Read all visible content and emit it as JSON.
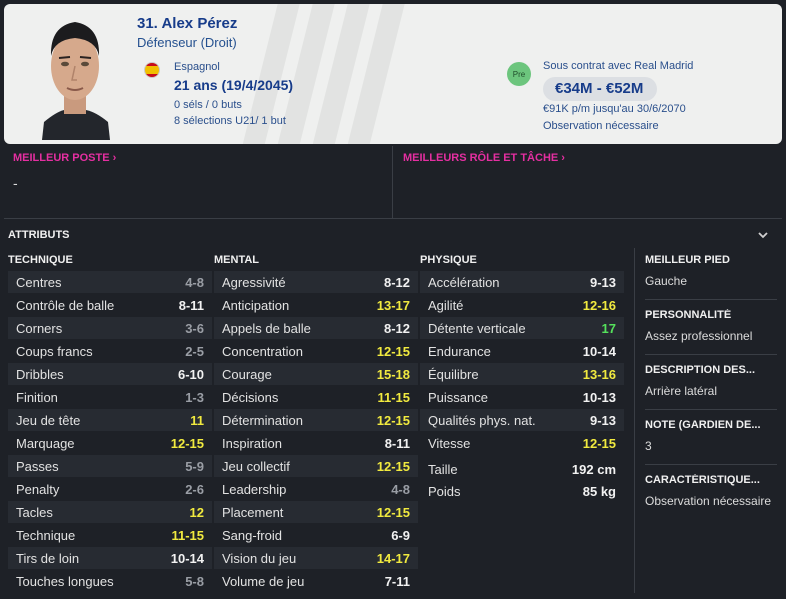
{
  "player": {
    "name": "31. Alex Pérez",
    "position": "Défenseur (Droit)",
    "nationality": "Espagnol",
    "age": "21 ans (19/4/2045)",
    "caps": "0 séls / 0 buts",
    "u21": "8 sélections U21/ 1 but"
  },
  "contract": {
    "badge": "Pre",
    "club_line": "Sous contrat avec Real Madrid",
    "value": "€34M - €52M",
    "wage": "€91K p/m jusqu'au 30/6/2070",
    "observation": "Observation nécessaire"
  },
  "best_position": {
    "title": "MEILLEUR POSTE",
    "value": "-"
  },
  "best_role": {
    "title": "MEILLEURS RÔLE ET TÂCHE"
  },
  "attributes_title": "ATTRIBUTS",
  "colors": {
    "grey": "#9a9ea5",
    "white": "#f2f2f2",
    "yellow": "#f1ea3f",
    "green": "#55e25c",
    "accent": "#e52fa1"
  },
  "technique": {
    "title": "TECHNIQUE",
    "rows": [
      {
        "label": "Centres",
        "value": "4-8",
        "tone": "grey"
      },
      {
        "label": "Contrôle de balle",
        "value": "8-11",
        "tone": "white"
      },
      {
        "label": "Corners",
        "value": "3-6",
        "tone": "grey"
      },
      {
        "label": "Coups francs",
        "value": "2-5",
        "tone": "grey"
      },
      {
        "label": "Dribbles",
        "value": "6-10",
        "tone": "white"
      },
      {
        "label": "Finition",
        "value": "1-3",
        "tone": "grey"
      },
      {
        "label": "Jeu de tête",
        "value": "11",
        "tone": "yellow"
      },
      {
        "label": "Marquage",
        "value": "12-15",
        "tone": "yellow"
      },
      {
        "label": "Passes",
        "value": "5-9",
        "tone": "grey"
      },
      {
        "label": "Penalty",
        "value": "2-6",
        "tone": "grey"
      },
      {
        "label": "Tacles",
        "value": "12",
        "tone": "yellow"
      },
      {
        "label": "Technique",
        "value": "11-15",
        "tone": "yellow"
      },
      {
        "label": "Tirs de loin",
        "value": "10-14",
        "tone": "white"
      },
      {
        "label": "Touches longues",
        "value": "5-8",
        "tone": "grey"
      }
    ]
  },
  "mental": {
    "title": "MENTAL",
    "rows": [
      {
        "label": "Agressivité",
        "value": "8-12",
        "tone": "white"
      },
      {
        "label": "Anticipation",
        "value": "13-17",
        "tone": "yellow"
      },
      {
        "label": "Appels de balle",
        "value": "8-12",
        "tone": "white"
      },
      {
        "label": "Concentration",
        "value": "12-15",
        "tone": "yellow"
      },
      {
        "label": "Courage",
        "value": "15-18",
        "tone": "yellow"
      },
      {
        "label": "Décisions",
        "value": "11-15",
        "tone": "yellow"
      },
      {
        "label": "Détermination",
        "value": "12-15",
        "tone": "yellow"
      },
      {
        "label": "Inspiration",
        "value": "8-11",
        "tone": "white"
      },
      {
        "label": "Jeu collectif",
        "value": "12-15",
        "tone": "yellow"
      },
      {
        "label": "Leadership",
        "value": "4-8",
        "tone": "grey"
      },
      {
        "label": "Placement",
        "value": "12-15",
        "tone": "yellow"
      },
      {
        "label": "Sang-froid",
        "value": "6-9",
        "tone": "white"
      },
      {
        "label": "Vision du jeu",
        "value": "14-17",
        "tone": "yellow"
      },
      {
        "label": "Volume de jeu",
        "value": "7-11",
        "tone": "white"
      }
    ]
  },
  "physique": {
    "title": "PHYSIQUE",
    "rows": [
      {
        "label": "Accélération",
        "value": "9-13",
        "tone": "white"
      },
      {
        "label": "Agilité",
        "value": "12-16",
        "tone": "yellow"
      },
      {
        "label": "Détente verticale",
        "value": "17",
        "tone": "green"
      },
      {
        "label": "Endurance",
        "value": "10-14",
        "tone": "white"
      },
      {
        "label": "Équilibre",
        "value": "13-16",
        "tone": "yellow"
      },
      {
        "label": "Puissance",
        "value": "10-13",
        "tone": "white"
      },
      {
        "label": "Qualités phys. nat.",
        "value": "9-13",
        "tone": "white"
      },
      {
        "label": "Vitesse",
        "value": "12-15",
        "tone": "yellow"
      }
    ],
    "height_label": "Taille",
    "height_value": "192 cm",
    "weight_label": "Poids",
    "weight_value": "85 kg"
  },
  "side": [
    {
      "title": "MEILLEUR PIED",
      "value": "Gauche"
    },
    {
      "title": "PERSONNALITÉ",
      "value": "Assez professionnel"
    },
    {
      "title": "DESCRIPTION DES...",
      "value": "Arrière latéral"
    },
    {
      "title": "NOTE (GARDIEN DE...",
      "value": "3"
    },
    {
      "title": "CARACTÉRISTIQUE...",
      "value": "Observation nécessaire"
    }
  ]
}
